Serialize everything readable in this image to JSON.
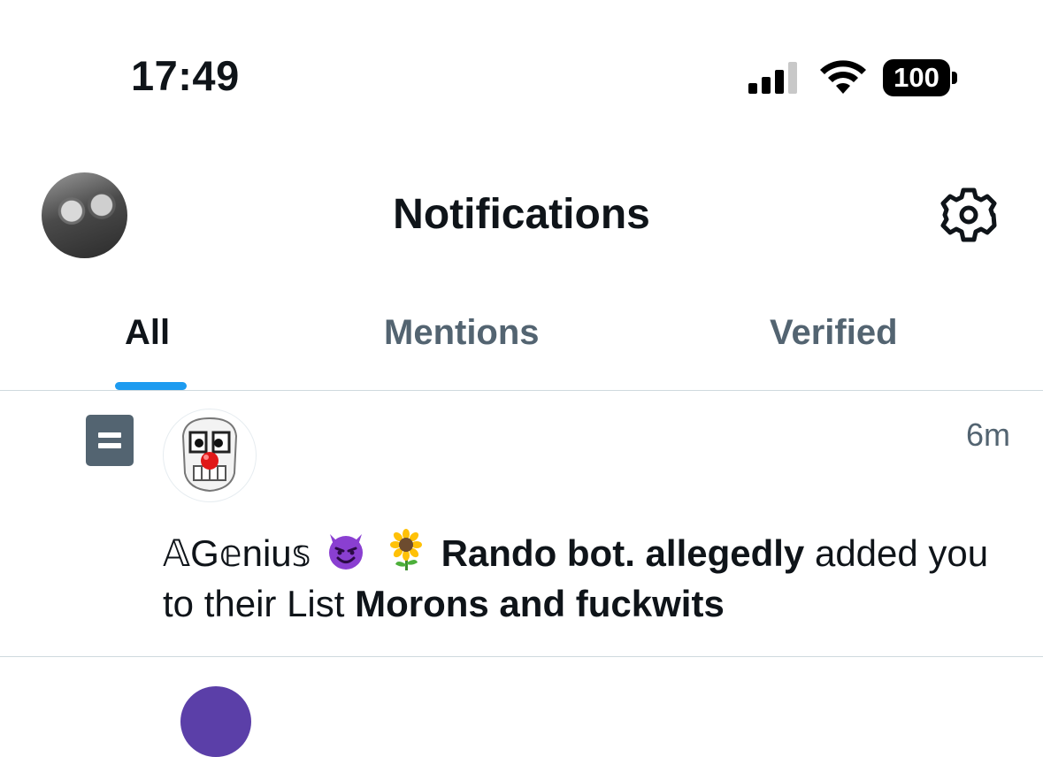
{
  "status_bar": {
    "time": "17:49",
    "battery": "100"
  },
  "header": {
    "title": "Notifications"
  },
  "tabs": [
    {
      "label": "All",
      "active": true
    },
    {
      "label": "Mentions",
      "active": false
    },
    {
      "label": "Verified",
      "active": false
    }
  ],
  "notifications": [
    {
      "icon": "list-icon",
      "time": "6m",
      "display_name": "𝔸G𝕖niu𝕤",
      "name_emojis": [
        "smiling-devil-emoji",
        "sunflower-emoji"
      ],
      "name_bold": "Rando bot. allegedly",
      "action": "added you to their List",
      "list_name": "Morons and fuckwits"
    }
  ],
  "colors": {
    "accent": "#1d9bf0",
    "text_primary": "#0f1419",
    "text_secondary": "#536471"
  }
}
